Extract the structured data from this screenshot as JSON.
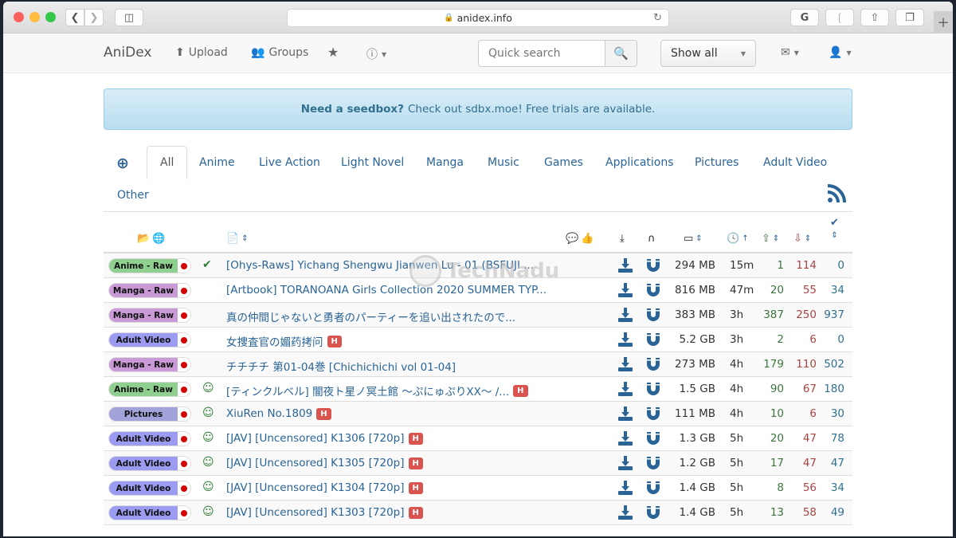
{
  "browser": {
    "url": "anidex.info",
    "icons": [
      "back-icon",
      "forward-icon",
      "sidebar-icon",
      "lock-icon",
      "reload-icon",
      "grammarly-icon",
      "rss-icon",
      "share-icon",
      "tabs-icon",
      "new-tab-icon"
    ]
  },
  "navbar": {
    "brand": "AniDex",
    "upload": "Upload",
    "groups": "Groups",
    "search_placeholder": "Quick search",
    "filter_selected": "Show all"
  },
  "alert": {
    "bold": "Need a seedbox?",
    "text": "Check out sdbx.moe! Free trials are available."
  },
  "tabs": [
    "All",
    "Anime",
    "Live Action",
    "Light Novel",
    "Manga",
    "Music",
    "Games",
    "Applications",
    "Pictures",
    "Adult Video",
    "Other"
  ],
  "active_tab": "All",
  "colors": {
    "link": "#2a6496",
    "seeders": "#3c763d",
    "leechers": "#a94442",
    "completed": "#31708f",
    "anime_raw": "#8fcf8f",
    "manga_raw": "#c99ad6",
    "adult_video": "#9b9bf2",
    "pictures": "#a3a3dc",
    "h_badge": "#d9534f"
  },
  "watermark": "TechNadu",
  "rows": [
    {
      "category": "Anime - Raw",
      "cat_color": "#8fcf8f",
      "status": "✔",
      "title": "[Ohys-Raws] Yichang Shengwu Jianwen Lu - 01 (BSFUJI ...",
      "h": false,
      "size": "294 MB",
      "age": "15m",
      "seeders": "1",
      "leechers": "114",
      "completed": "0"
    },
    {
      "category": "Manga - Raw",
      "cat_color": "#c99ad6",
      "status": "",
      "title": "[Artbook] TORANOANA Girls Collection 2020 SUMMER TYP...",
      "h": false,
      "size": "816 MB",
      "age": "47m",
      "seeders": "20",
      "leechers": "55",
      "completed": "34"
    },
    {
      "category": "Manga - Raw",
      "cat_color": "#c99ad6",
      "status": "",
      "title": "真の仲間じゃないと勇者のパーティーを追い出されたので...",
      "h": false,
      "size": "383 MB",
      "age": "3h",
      "seeders": "387",
      "leechers": "250",
      "completed": "937"
    },
    {
      "category": "Adult Video",
      "cat_color": "#9b9bf2",
      "status": "",
      "title": "女捜査官の媚药拷问",
      "h": true,
      "size": "5.2 GB",
      "age": "3h",
      "seeders": "2",
      "leechers": "6",
      "completed": "0"
    },
    {
      "category": "Manga - Raw",
      "cat_color": "#c99ad6",
      "status": "",
      "title": "チチチチ 第01-04巻 [Chichichichi vol 01-04]",
      "h": false,
      "size": "273 MB",
      "age": "4h",
      "seeders": "179",
      "leechers": "110",
      "completed": "502"
    },
    {
      "category": "Anime - Raw",
      "cat_color": "#8fcf8f",
      "status": "☺",
      "title": "[ティンクルベル] 闇夜ト星ノ冥土館 ～ぷにゅぷりXX～ /...",
      "h": true,
      "size": "1.5 GB",
      "age": "4h",
      "seeders": "90",
      "leechers": "67",
      "completed": "180"
    },
    {
      "category": "Pictures",
      "cat_color": "#a3a3dc",
      "status": "☺",
      "title": "XiuRen No.1809",
      "h": true,
      "size": "111 MB",
      "age": "4h",
      "seeders": "10",
      "leechers": "6",
      "completed": "30"
    },
    {
      "category": "Adult Video",
      "cat_color": "#9b9bf2",
      "status": "☺",
      "title": "[JAV] [Uncensored] K1306 [720p]",
      "h": true,
      "size": "1.3 GB",
      "age": "5h",
      "seeders": "20",
      "leechers": "47",
      "completed": "78"
    },
    {
      "category": "Adult Video",
      "cat_color": "#9b9bf2",
      "status": "☺",
      "title": "[JAV] [Uncensored] K1305 [720p]",
      "h": true,
      "size": "1.2 GB",
      "age": "5h",
      "seeders": "17",
      "leechers": "47",
      "completed": "47"
    },
    {
      "category": "Adult Video",
      "cat_color": "#9b9bf2",
      "status": "☺",
      "title": "[JAV] [Uncensored] K1304 [720p]",
      "h": true,
      "size": "1.4 GB",
      "age": "5h",
      "seeders": "8",
      "leechers": "56",
      "completed": "34"
    },
    {
      "category": "Adult Video",
      "cat_color": "#9b9bf2",
      "status": "☺",
      "title": "[JAV] [Uncensored] K1303 [720p]",
      "h": true,
      "size": "1.4 GB",
      "age": "5h",
      "seeders": "13",
      "leechers": "58",
      "completed": "49"
    }
  ],
  "h_label": "H"
}
